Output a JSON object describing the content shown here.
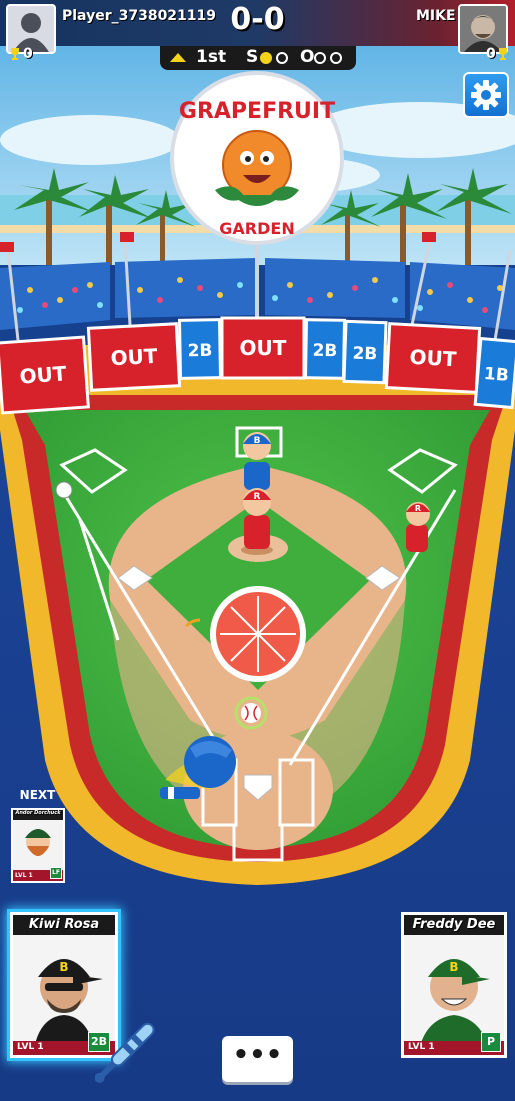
{
  "players": {
    "left": {
      "name": "Player_3738021119",
      "trophies": "0"
    },
    "right": {
      "name": "MIKE",
      "trophies": "0"
    }
  },
  "score": "0-0",
  "inning": {
    "label": "1st",
    "half": "top",
    "strikes_label": "S",
    "outs_label": "O",
    "strikes": 1,
    "outs": 0
  },
  "stadium": {
    "sign_top": "GRAPEFRUIT",
    "sign_bottom": "GARDEN"
  },
  "wall_targets": [
    "OUT",
    "OUT",
    "2B",
    "OUT",
    "2B",
    "2B",
    "OUT",
    "1B"
  ],
  "fielder_letters": [
    "B",
    "R",
    "R"
  ],
  "next": {
    "heading": "NEXT",
    "player": "Andor Dorchuck",
    "level": "LVL 1",
    "position": "LF"
  },
  "batter_card": {
    "player": "Kiwi Rosa",
    "level": "LVL 1",
    "position": "2B"
  },
  "pitcher_card": {
    "player": "Freddy Dee",
    "level": "LVL 1",
    "position": "P"
  },
  "chat_button": "•••",
  "colors": {
    "accent_blue": "#1b7bd9",
    "wall_red": "#d7222b",
    "grass": "#3fae3c",
    "dirt": "#e8b48a"
  }
}
